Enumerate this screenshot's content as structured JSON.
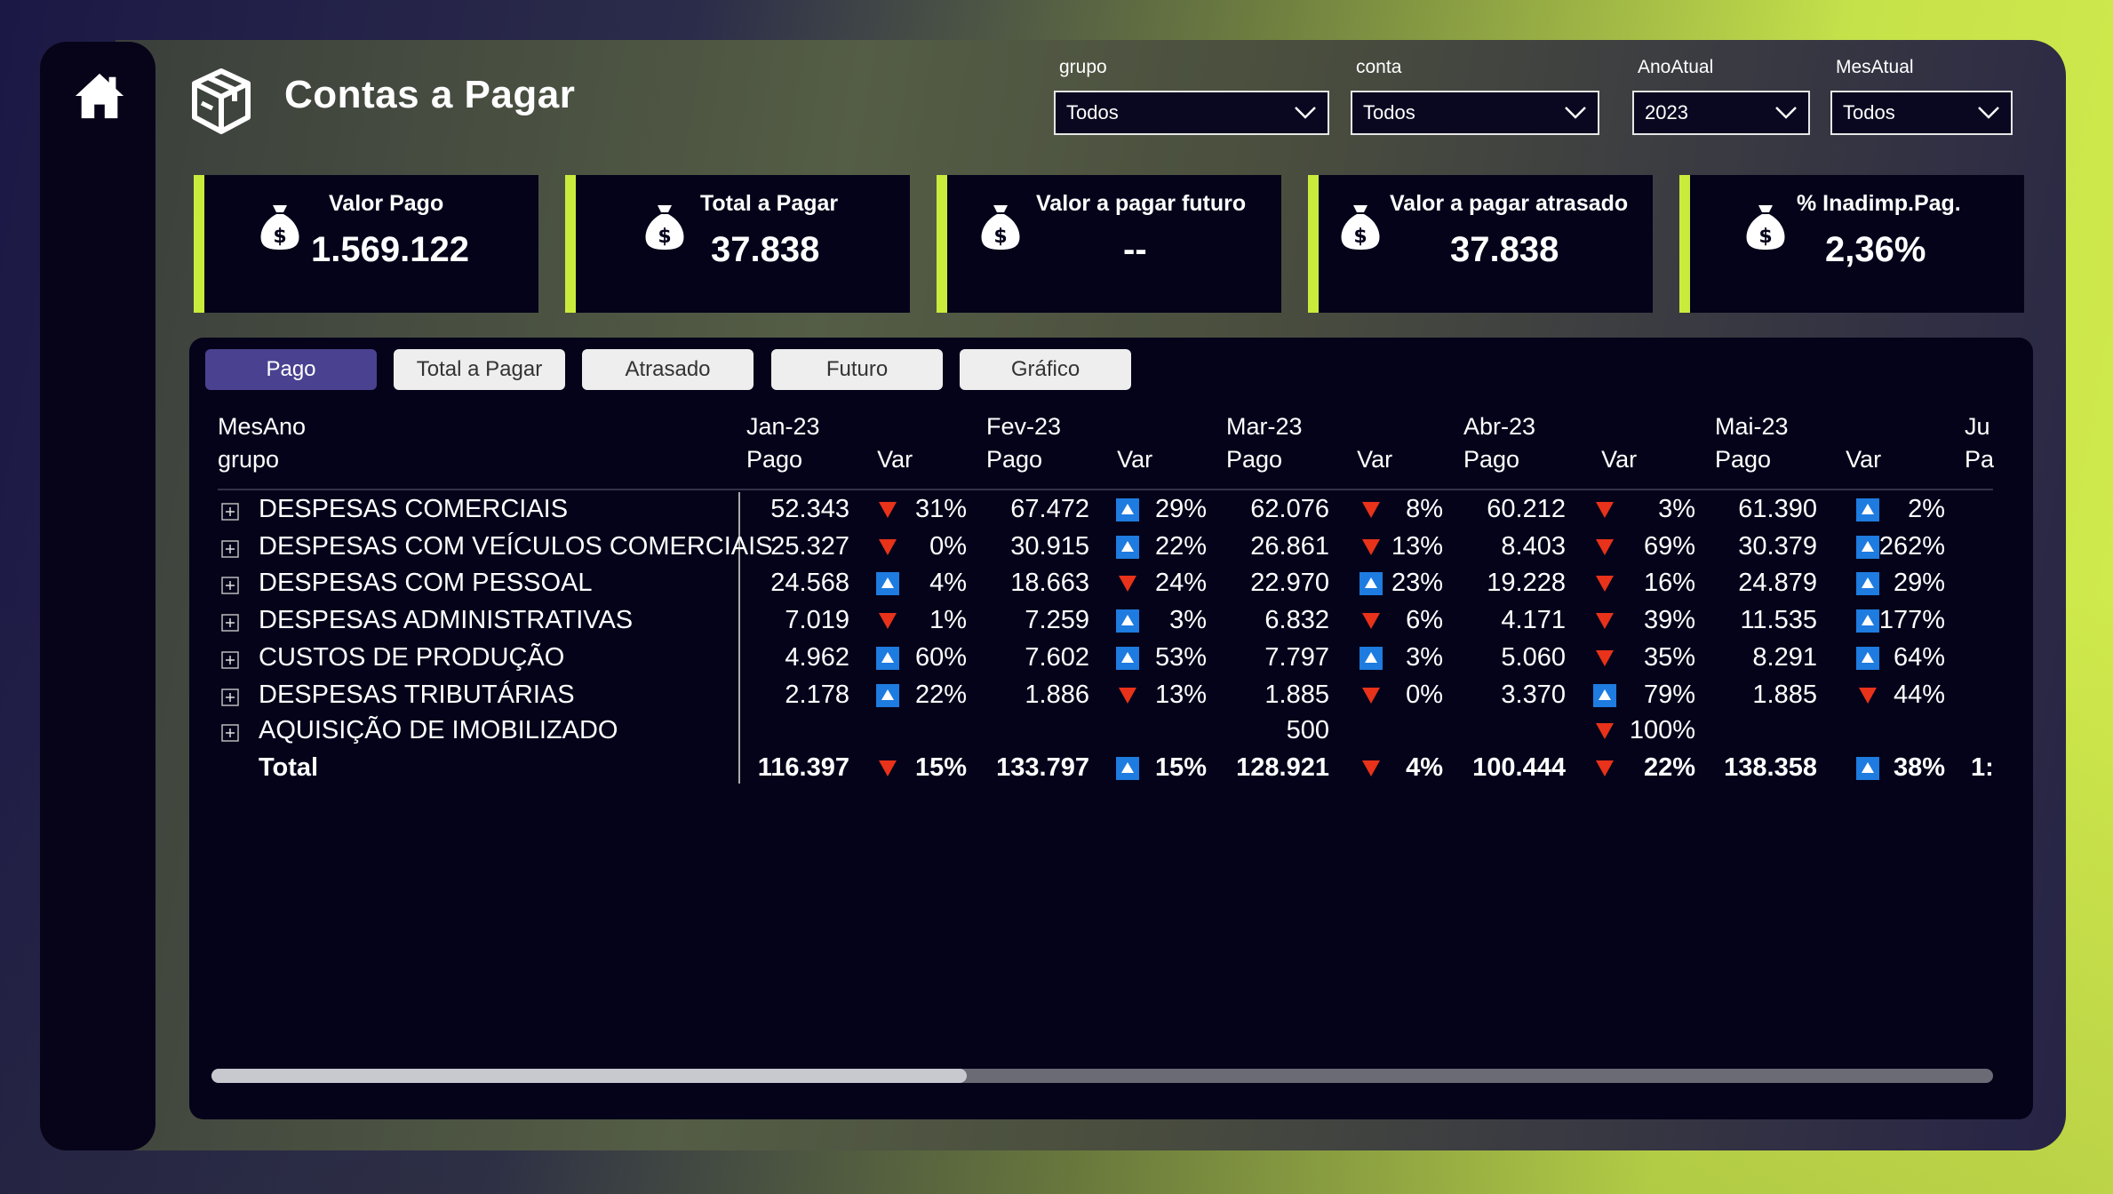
{
  "header": {
    "title": "Contas a Pagar"
  },
  "filters": [
    {
      "label": "grupo",
      "value": "Todos"
    },
    {
      "label": "conta",
      "value": "Todos"
    },
    {
      "label": "AnoAtual",
      "value": "2023"
    },
    {
      "label": "MesAtual",
      "value": "Todos"
    }
  ],
  "cards": [
    {
      "label": "Valor Pago",
      "value": "1.569.122"
    },
    {
      "label": "Total a Pagar",
      "value": "37.838"
    },
    {
      "label": "Valor a pagar futuro",
      "value": "--"
    },
    {
      "label": "Valor a pagar atrasado",
      "value": "37.838"
    },
    {
      "label": "% Inadimp.Pag.",
      "value": "2,36%"
    }
  ],
  "tabs": [
    "Pago",
    "Total a Pagar",
    "Atrasado",
    "Futuro",
    "Gráfico"
  ],
  "table": {
    "row_header_1": "MesAno",
    "row_header_2": "grupo",
    "months": [
      "Jan-23",
      "Fev-23",
      "Mar-23",
      "Abr-23",
      "Mai-23",
      "Ju"
    ],
    "sub_pago": "Pago",
    "sub_pago_cut": "Pa",
    "sub_var": "Var",
    "rows": [
      {
        "name": "DESPESAS COMERCIAIS",
        "cells": [
          {
            "v": "52.343",
            "d": "down",
            "p": "31%"
          },
          {
            "v": "67.472",
            "d": "up",
            "p": "29%"
          },
          {
            "v": "62.076",
            "d": "down",
            "p": "8%"
          },
          {
            "v": "60.212",
            "d": "down",
            "p": "3%"
          },
          {
            "v": "61.390",
            "d": "up",
            "p": "2%"
          }
        ]
      },
      {
        "name": "DESPESAS COM VEÍCULOS COMERCIAIS",
        "cells": [
          {
            "v": "25.327",
            "d": "down",
            "p": "0%"
          },
          {
            "v": "30.915",
            "d": "up",
            "p": "22%"
          },
          {
            "v": "26.861",
            "d": "down",
            "p": "13%"
          },
          {
            "v": "8.403",
            "d": "down",
            "p": "69%"
          },
          {
            "v": "30.379",
            "d": "up",
            "p": "262%"
          }
        ]
      },
      {
        "name": "DESPESAS COM PESSOAL",
        "cells": [
          {
            "v": "24.568",
            "d": "up",
            "p": "4%"
          },
          {
            "v": "18.663",
            "d": "down",
            "p": "24%"
          },
          {
            "v": "22.970",
            "d": "up",
            "p": "23%"
          },
          {
            "v": "19.228",
            "d": "down",
            "p": "16%"
          },
          {
            "v": "24.879",
            "d": "up",
            "p": "29%"
          }
        ]
      },
      {
        "name": "DESPESAS ADMINISTRATIVAS",
        "cells": [
          {
            "v": "7.019",
            "d": "down",
            "p": "1%"
          },
          {
            "v": "7.259",
            "d": "up",
            "p": "3%"
          },
          {
            "v": "6.832",
            "d": "down",
            "p": "6%"
          },
          {
            "v": "4.171",
            "d": "down",
            "p": "39%"
          },
          {
            "v": "11.535",
            "d": "up",
            "p": "177%"
          }
        ]
      },
      {
        "name": "CUSTOS DE PRODUÇÃO",
        "cells": [
          {
            "v": "4.962",
            "d": "up",
            "p": "60%"
          },
          {
            "v": "7.602",
            "d": "up",
            "p": "53%"
          },
          {
            "v": "7.797",
            "d": "up",
            "p": "3%"
          },
          {
            "v": "5.060",
            "d": "down",
            "p": "35%"
          },
          {
            "v": "8.291",
            "d": "up",
            "p": "64%"
          }
        ]
      },
      {
        "name": "DESPESAS TRIBUTÁRIAS",
        "cells": [
          {
            "v": "2.178",
            "d": "up",
            "p": "22%"
          },
          {
            "v": "1.886",
            "d": "down",
            "p": "13%"
          },
          {
            "v": "1.885",
            "d": "down",
            "p": "0%"
          },
          {
            "v": "3.370",
            "d": "up",
            "p": "79%"
          },
          {
            "v": "1.885",
            "d": "down",
            "p": "44%"
          }
        ]
      },
      {
        "name": "AQUISIÇÃO DE IMOBILIZADO",
        "cells": [
          {
            "v": "",
            "d": "",
            "p": ""
          },
          {
            "v": "",
            "d": "",
            "p": ""
          },
          {
            "v": "500",
            "d": "",
            "p": ""
          },
          {
            "v": "",
            "d": "down",
            "p": "100%"
          },
          {
            "v": "",
            "d": "",
            "p": ""
          }
        ]
      }
    ],
    "total": {
      "name": "Total",
      "cells": [
        {
          "v": "116.397",
          "d": "down",
          "p": "15%"
        },
        {
          "v": "133.797",
          "d": "up",
          "p": "15%"
        },
        {
          "v": "128.921",
          "d": "down",
          "p": "4%"
        },
        {
          "v": "100.444",
          "d": "down",
          "p": "22%"
        },
        {
          "v": "138.358",
          "d": "up",
          "p": "38%"
        }
      ],
      "cut": "1:"
    },
    "colors": {
      "up": "#1e7be0",
      "down": "#e8321a"
    }
  }
}
